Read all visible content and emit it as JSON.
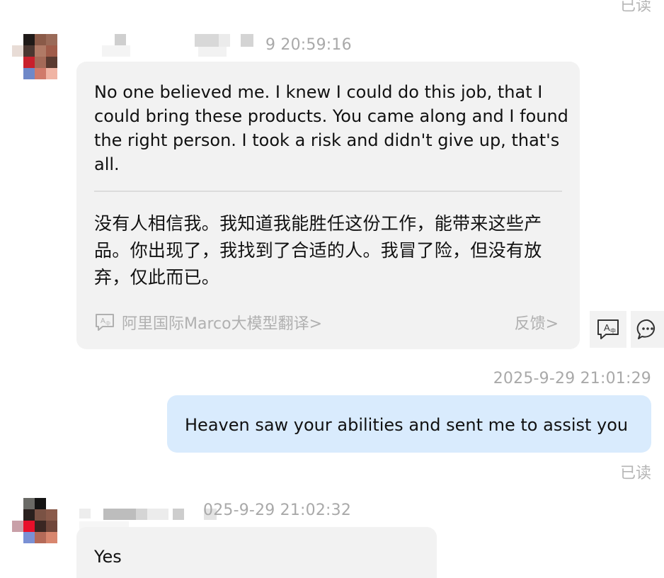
{
  "top_read_status": "已读",
  "messages": [
    {
      "timestamp": "9 20:59:16",
      "english": "No one believed me. I knew I could do this job, that I could bring these products. You came along and I found the right person. I took a risk and didn't give up, that's all.",
      "chinese": "没有人相信我。我知道我能胜任这份工作，能带来这些产品。你出现了，我找到了合适的人。我冒了险，但没有放弃，仅此而已。",
      "translation_provider": "阿里国际Marco大模型翻译>",
      "feedback_label": "反馈>"
    },
    {
      "timestamp": "2025-9-29 21:01:29",
      "text": "Heaven saw your abilities and sent me to assist you",
      "read_status": "已读"
    },
    {
      "timestamp": "025-9-29 21:02:32",
      "text": "Yes"
    }
  ],
  "icons": {
    "translate": "translate-icon",
    "reply": "chat-bubble-icon",
    "provider": "translate-badge-icon"
  },
  "colors": {
    "incoming_bubble": "#f2f2f2",
    "outgoing_bubble": "#d9ebfd",
    "timestamp": "#a9a9a9",
    "muted": "#b0b0b0"
  }
}
